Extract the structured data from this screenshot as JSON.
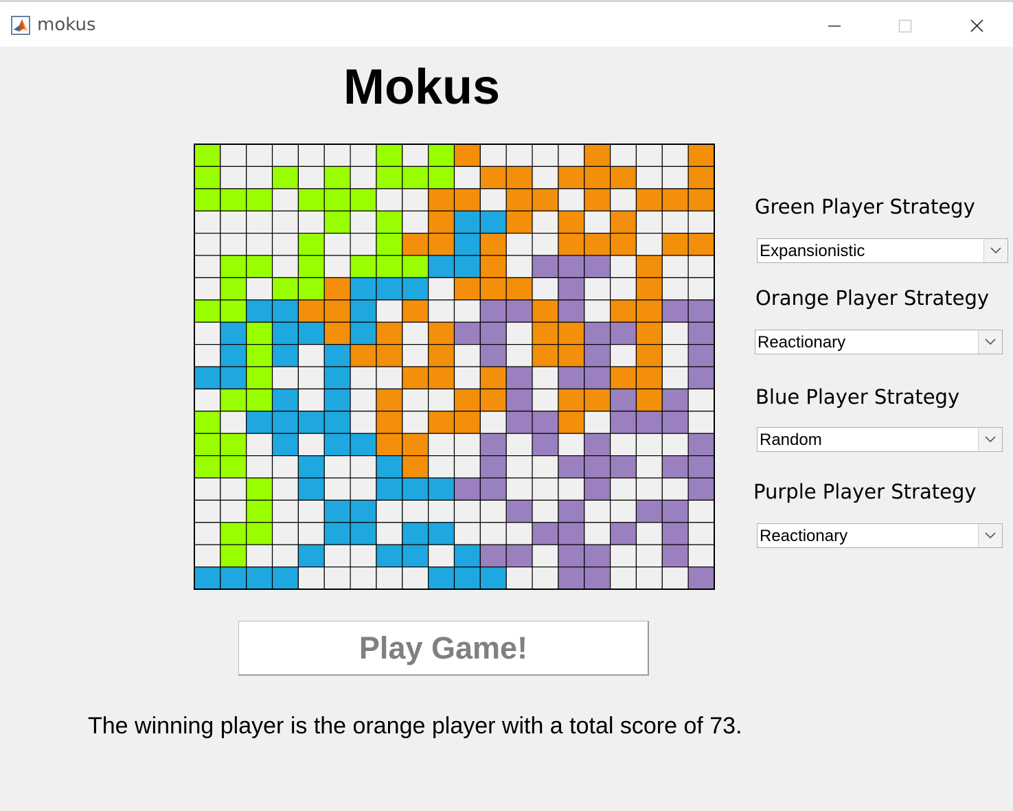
{
  "window": {
    "title": "mokus",
    "icon": "matlab-icon",
    "controls": [
      "minimize-icon",
      "maximize-icon",
      "close-icon"
    ]
  },
  "header": {
    "title": "Mokus"
  },
  "colors": {
    "G": "#99ff00",
    "O": "#f38f0a",
    "B": "#1fa7df",
    "P": "#9b80bf",
    ".": "#f0f0f0",
    "gridline": "#000000"
  },
  "board": {
    "rows": 20,
    "cols": 20,
    "legend": {
      "G": "green",
      "O": "orange",
      "B": "blue",
      "P": "purple",
      ".": "empty"
    },
    "cells": [
      "G......G.GO....O...O",
      "G..G.G.GGG.OO.OOO..O",
      "GGG.GGG..OO.OO.O.OOO",
      ".....G.G.OBBO.O.O...",
      "....G..GOOBO..OOO.OO",
      ".GG.G.GGGBBO.PPP.O..",
      ".G.GGOBBB.OOO.P..O..",
      "GGBBOOB.O..PPOP.OOPP",
      ".BGBBOBO.OPP.OOPPO.P",
      ".BGB.BOO.O.P.OOP.O.P",
      "BBG..B..OO.OP.PPOO.P",
      ".GGB.B.O..OOP.OOPOP.",
      "G.BBBB.O.OO.PPO.PPP.",
      "GG.B.BBOO..P.P.P...P",
      "GG..B..BO..P..PPP.PP",
      "..G.B..BBBPP...P...P",
      "..G..BB.....P.P..PP.",
      ".GG..BB.BB...PP.P.P.",
      ".G..B..BB.BPP.PP..P.",
      "BBBB.....BBB..PP...P"
    ]
  },
  "strategies": {
    "green": {
      "label": "Green Player Strategy",
      "value": "Expansionistic"
    },
    "orange": {
      "label": "Orange Player Strategy",
      "value": "Reactionary"
    },
    "blue": {
      "label": "Blue Player Strategy",
      "value": "Random"
    },
    "purple": {
      "label": "Purple Player Strategy",
      "value": "Reactionary"
    }
  },
  "play_button": {
    "label": "Play Game!"
  },
  "result": {
    "text": "The winning player is the orange player with a total score of 73."
  }
}
